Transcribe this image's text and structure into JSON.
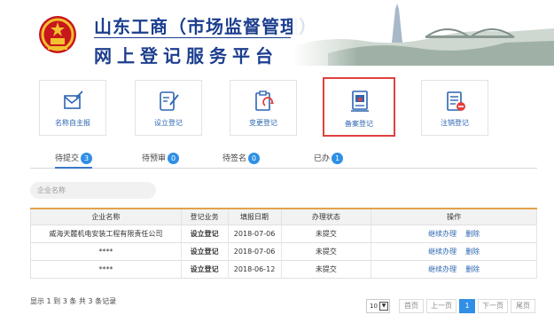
{
  "header": {
    "title_line1": "山东工商（市场监督管理）",
    "title_line2": "网上登记服务平台"
  },
  "tiles": [
    {
      "label": "名称自主报",
      "icon": "envelope-pen-icon"
    },
    {
      "label": "设立登记",
      "icon": "doc-pen-icon"
    },
    {
      "label": "变更登记",
      "icon": "clipboard-refresh-icon"
    },
    {
      "label": "备案登记",
      "icon": "star-document-icon",
      "selected": true
    },
    {
      "label": "注销登记",
      "icon": "doc-minus-icon"
    }
  ],
  "tabs": [
    {
      "label": "待提交",
      "count": "3",
      "active": true
    },
    {
      "label": "待预审",
      "count": "0"
    },
    {
      "label": "待签名",
      "count": "0"
    },
    {
      "label": "已办",
      "count": "1"
    }
  ],
  "search": {
    "placeholder": "企业名称"
  },
  "table": {
    "headers": [
      "企业名称",
      "登记业务",
      "填报日期",
      "办理状态",
      "操作"
    ],
    "rows": [
      {
        "name": "威海天麓机电安装工程有限责任公司",
        "business": "设立登记",
        "date": "2018-07-06",
        "status": "未提交",
        "action1": "继续办理",
        "action2": "删除"
      },
      {
        "name": "****",
        "business": "设立登记",
        "date": "2018-07-06",
        "status": "未提交",
        "action1": "继续办理",
        "action2": "删除"
      },
      {
        "name": "****",
        "business": "设立登记",
        "date": "2018-06-12",
        "status": "未提交",
        "action1": "继续办理",
        "action2": "删除"
      }
    ]
  },
  "footer": {
    "summary": "显示 1 到 3 条 共 3 条记录",
    "page_size": "10",
    "first": "首页",
    "prev": "上一页",
    "current": "1",
    "next": "下一页",
    "last": "尾页"
  },
  "colors": {
    "title_blue": "#1c3e8f",
    "link_blue": "#2d66b1",
    "badge_blue": "#2f8fe6",
    "selected_border": "#e0413e",
    "table_header_rule": "#e2a34a"
  }
}
